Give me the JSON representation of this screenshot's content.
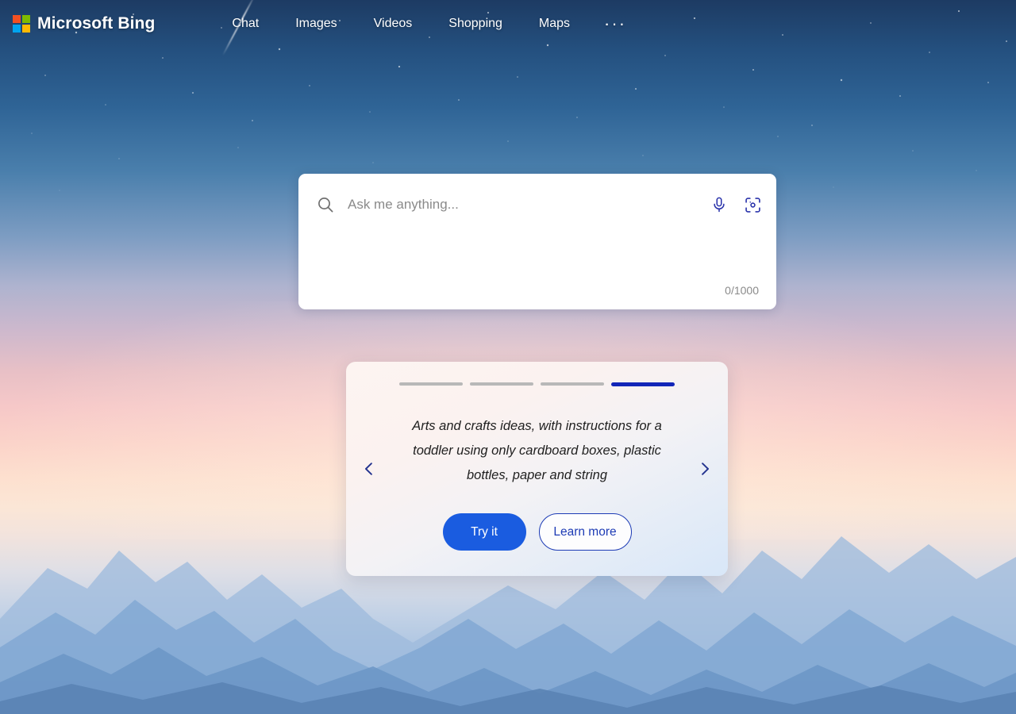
{
  "header": {
    "brand": "Microsoft Bing",
    "logo_icon": "microsoft-logo-icon",
    "logo_colors": [
      "#f25022",
      "#7fba00",
      "#00a4ef",
      "#ffb900"
    ],
    "nav": [
      {
        "label": "Chat"
      },
      {
        "label": "Images"
      },
      {
        "label": "Videos"
      },
      {
        "label": "Shopping"
      },
      {
        "label": "Maps"
      }
    ],
    "more_label": "···"
  },
  "search": {
    "icon": "search-icon",
    "placeholder": "Ask me anything...",
    "value": "",
    "counter": "0/1000",
    "mic_icon": "microphone-icon",
    "visual_search_icon": "visual-search-icon",
    "accent": "#2b34ab"
  },
  "carousel": {
    "total": 4,
    "active_index": 3,
    "suggestion": "Arts and crafts ideas, with instructions for a toddler using only cardboard boxes, plastic bottles, paper and string",
    "prev_icon": "chevron-left-icon",
    "next_icon": "chevron-right-icon",
    "primary_button": "Try it",
    "secondary_button": "Learn more",
    "active_color": "#1226b8",
    "inactive_color": "#b8b8b8",
    "primary_color": "#1a5ce0",
    "secondary_color": "#1d3bb5"
  },
  "background": {
    "description": "Sunset mountain landscape with starry night sky",
    "sky_top": "#1d3b63",
    "sky_mid": "#f6c8c8",
    "sky_low": "#fde0cf",
    "mountain": "#93b4da"
  }
}
